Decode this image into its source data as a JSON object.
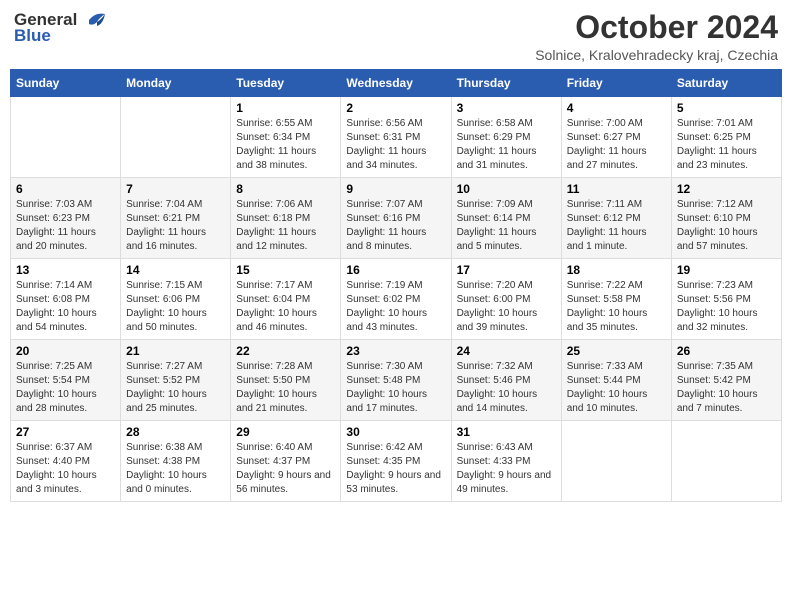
{
  "header": {
    "logo_general": "General",
    "logo_blue": "Blue",
    "month_title": "October 2024",
    "subtitle": "Solnice, Kralovehradecky kraj, Czechia"
  },
  "days_of_week": [
    "Sunday",
    "Monday",
    "Tuesday",
    "Wednesday",
    "Thursday",
    "Friday",
    "Saturday"
  ],
  "weeks": [
    [
      {
        "day": "",
        "info": ""
      },
      {
        "day": "",
        "info": ""
      },
      {
        "day": "1",
        "info": "Sunrise: 6:55 AM\nSunset: 6:34 PM\nDaylight: 11 hours and 38 minutes."
      },
      {
        "day": "2",
        "info": "Sunrise: 6:56 AM\nSunset: 6:31 PM\nDaylight: 11 hours and 34 minutes."
      },
      {
        "day": "3",
        "info": "Sunrise: 6:58 AM\nSunset: 6:29 PM\nDaylight: 11 hours and 31 minutes."
      },
      {
        "day": "4",
        "info": "Sunrise: 7:00 AM\nSunset: 6:27 PM\nDaylight: 11 hours and 27 minutes."
      },
      {
        "day": "5",
        "info": "Sunrise: 7:01 AM\nSunset: 6:25 PM\nDaylight: 11 hours and 23 minutes."
      }
    ],
    [
      {
        "day": "6",
        "info": "Sunrise: 7:03 AM\nSunset: 6:23 PM\nDaylight: 11 hours and 20 minutes."
      },
      {
        "day": "7",
        "info": "Sunrise: 7:04 AM\nSunset: 6:21 PM\nDaylight: 11 hours and 16 minutes."
      },
      {
        "day": "8",
        "info": "Sunrise: 7:06 AM\nSunset: 6:18 PM\nDaylight: 11 hours and 12 minutes."
      },
      {
        "day": "9",
        "info": "Sunrise: 7:07 AM\nSunset: 6:16 PM\nDaylight: 11 hours and 8 minutes."
      },
      {
        "day": "10",
        "info": "Sunrise: 7:09 AM\nSunset: 6:14 PM\nDaylight: 11 hours and 5 minutes."
      },
      {
        "day": "11",
        "info": "Sunrise: 7:11 AM\nSunset: 6:12 PM\nDaylight: 11 hours and 1 minute."
      },
      {
        "day": "12",
        "info": "Sunrise: 7:12 AM\nSunset: 6:10 PM\nDaylight: 10 hours and 57 minutes."
      }
    ],
    [
      {
        "day": "13",
        "info": "Sunrise: 7:14 AM\nSunset: 6:08 PM\nDaylight: 10 hours and 54 minutes."
      },
      {
        "day": "14",
        "info": "Sunrise: 7:15 AM\nSunset: 6:06 PM\nDaylight: 10 hours and 50 minutes."
      },
      {
        "day": "15",
        "info": "Sunrise: 7:17 AM\nSunset: 6:04 PM\nDaylight: 10 hours and 46 minutes."
      },
      {
        "day": "16",
        "info": "Sunrise: 7:19 AM\nSunset: 6:02 PM\nDaylight: 10 hours and 43 minutes."
      },
      {
        "day": "17",
        "info": "Sunrise: 7:20 AM\nSunset: 6:00 PM\nDaylight: 10 hours and 39 minutes."
      },
      {
        "day": "18",
        "info": "Sunrise: 7:22 AM\nSunset: 5:58 PM\nDaylight: 10 hours and 35 minutes."
      },
      {
        "day": "19",
        "info": "Sunrise: 7:23 AM\nSunset: 5:56 PM\nDaylight: 10 hours and 32 minutes."
      }
    ],
    [
      {
        "day": "20",
        "info": "Sunrise: 7:25 AM\nSunset: 5:54 PM\nDaylight: 10 hours and 28 minutes."
      },
      {
        "day": "21",
        "info": "Sunrise: 7:27 AM\nSunset: 5:52 PM\nDaylight: 10 hours and 25 minutes."
      },
      {
        "day": "22",
        "info": "Sunrise: 7:28 AM\nSunset: 5:50 PM\nDaylight: 10 hours and 21 minutes."
      },
      {
        "day": "23",
        "info": "Sunrise: 7:30 AM\nSunset: 5:48 PM\nDaylight: 10 hours and 17 minutes."
      },
      {
        "day": "24",
        "info": "Sunrise: 7:32 AM\nSunset: 5:46 PM\nDaylight: 10 hours and 14 minutes."
      },
      {
        "day": "25",
        "info": "Sunrise: 7:33 AM\nSunset: 5:44 PM\nDaylight: 10 hours and 10 minutes."
      },
      {
        "day": "26",
        "info": "Sunrise: 7:35 AM\nSunset: 5:42 PM\nDaylight: 10 hours and 7 minutes."
      }
    ],
    [
      {
        "day": "27",
        "info": "Sunrise: 6:37 AM\nSunset: 4:40 PM\nDaylight: 10 hours and 3 minutes."
      },
      {
        "day": "28",
        "info": "Sunrise: 6:38 AM\nSunset: 4:38 PM\nDaylight: 10 hours and 0 minutes."
      },
      {
        "day": "29",
        "info": "Sunrise: 6:40 AM\nSunset: 4:37 PM\nDaylight: 9 hours and 56 minutes."
      },
      {
        "day": "30",
        "info": "Sunrise: 6:42 AM\nSunset: 4:35 PM\nDaylight: 9 hours and 53 minutes."
      },
      {
        "day": "31",
        "info": "Sunrise: 6:43 AM\nSunset: 4:33 PM\nDaylight: 9 hours and 49 minutes."
      },
      {
        "day": "",
        "info": ""
      },
      {
        "day": "",
        "info": ""
      }
    ]
  ]
}
